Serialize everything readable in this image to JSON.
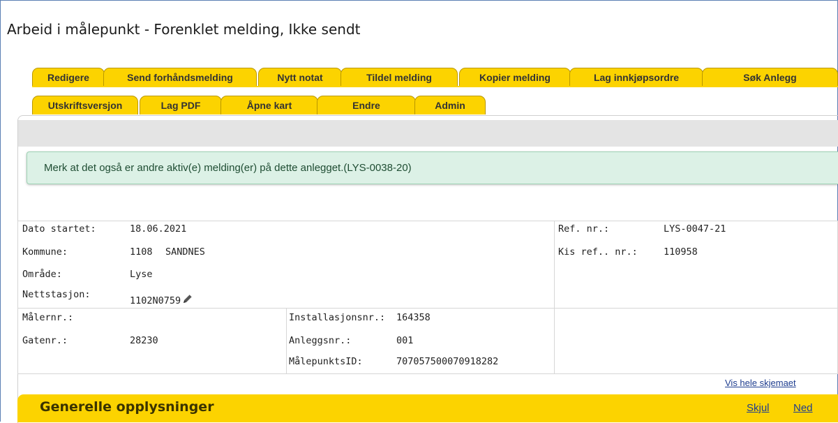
{
  "page": {
    "title": "Arbeid i målepunkt - Forenklet melding, Ikke sendt"
  },
  "tabs": {
    "row1": [
      "Redigere",
      "Send forhåndsmelding",
      "Nytt notat",
      "Tildel melding",
      "Kopier melding",
      "Lag innkjøpsordre",
      "Søk Anlegg"
    ],
    "row2": [
      "Utskriftsversjon",
      "Lag PDF",
      "Åpne kart",
      "Endre",
      "Admin"
    ]
  },
  "notice": {
    "text": "Merk at det også er andre aktiv(e) melding(er) på dette anlegget.(LYS-0038-20)"
  },
  "details": {
    "dato_startet_label": "Dato startet:",
    "dato_startet": "18.06.2021",
    "kommune_label": "Kommune:",
    "kommune_nr": "1108",
    "kommune_navn": "SANDNES",
    "omrade_label": "Område:",
    "omrade": "Lyse",
    "nettstasjon_label": "Nettstasjon:",
    "nettstasjon": "1102N0759",
    "ref_label": "Ref. nr.:",
    "ref": "LYS-0047-21",
    "kis_label": "Kis ref.. nr.:",
    "kis": "110958",
    "malernr_label": "Målernr.:",
    "malernr": "",
    "gatenr_label": "Gatenr.:",
    "gatenr": "28230",
    "installasjon_label": "Installasjonsnr.:",
    "installasjon": "164358",
    "anlegg_label": "Anleggsnr.:",
    "anlegg": "001",
    "malepunkt_label": "MålepunktsID:",
    "malepunkt": "707057500070918282"
  },
  "links": {
    "vis_hele": "Vis hele skjemaet",
    "skjul": "Skjul",
    "ned": "Ned"
  },
  "section": {
    "title": "Generelle opplysninger"
  },
  "colors": {
    "tab_yellow": "#fcd300",
    "notice_bg": "#dcf1e6",
    "link": "#1e3d8f"
  },
  "icons": {
    "nettstasjon_edit": "pencil-icon"
  }
}
